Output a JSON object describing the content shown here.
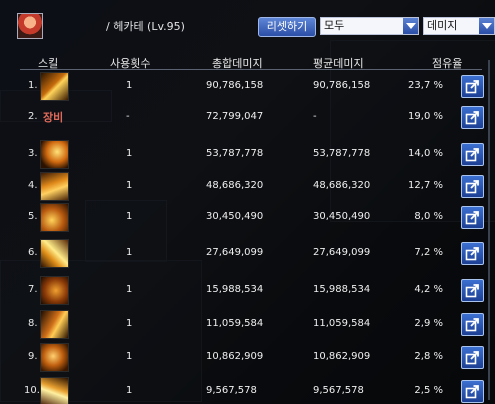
{
  "header": {
    "title": "/ 헤카테 (Lv.95)",
    "reset_label": "리셋하기",
    "filter_select": "모두",
    "type_select": "데미지"
  },
  "columns": {
    "skill": "스킬",
    "use_count": "사용횟수",
    "total_damage": "총합데미지",
    "avg_damage": "평균데미지",
    "share": "점유율"
  },
  "rows": [
    {
      "rank": "1.",
      "icon": "skill-1-icon",
      "use": "1",
      "total": "90,786,158",
      "avg": "90,786,158",
      "pct": "23,7 %"
    },
    {
      "rank": "2.",
      "icon": "equipment-label",
      "label": "장비",
      "use": "-",
      "total": "72,799,047",
      "avg": "-",
      "pct": "19,0 %"
    },
    {
      "rank": "3.",
      "icon": "skill-3-icon",
      "use": "1",
      "total": "53,787,778",
      "avg": "53,787,778",
      "pct": "14,0 %"
    },
    {
      "rank": "4.",
      "icon": "skill-4-icon",
      "use": "1",
      "total": "48,686,320",
      "avg": "48,686,320",
      "pct": "12,7 %"
    },
    {
      "rank": "5.",
      "icon": "skill-5-icon",
      "use": "1",
      "total": "30,450,490",
      "avg": "30,450,490",
      "pct": "8,0 %"
    },
    {
      "rank": "6.",
      "icon": "skill-6-icon",
      "use": "1",
      "total": "27,649,099",
      "avg": "27,649,099",
      "pct": "7,2 %"
    },
    {
      "rank": "7.",
      "icon": "skill-7-icon",
      "use": "1",
      "total": "15,988,534",
      "avg": "15,988,534",
      "pct": "4,2 %"
    },
    {
      "rank": "8.",
      "icon": "skill-8-icon",
      "use": "1",
      "total": "11,059,584",
      "avg": "11,059,584",
      "pct": "2,9 %"
    },
    {
      "rank": "9.",
      "icon": "skill-9-icon",
      "use": "1",
      "total": "10,862,909",
      "avg": "10,862,909",
      "pct": "2,8 %"
    },
    {
      "rank": "10.",
      "icon": "skill-10-icon",
      "use": "1",
      "total": "9,567,578",
      "avg": "9,567,578",
      "pct": "2,5 %"
    }
  ],
  "colors": {
    "accent": "#2b4ea6",
    "equip_label": "#e06a5a"
  }
}
